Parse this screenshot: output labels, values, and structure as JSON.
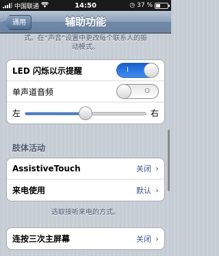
{
  "status_bar": {
    "carrier": "中国联通",
    "time": "14:50",
    "battery_text": "37 %",
    "battery_level": 0.37
  },
  "nav": {
    "back_label": "通用",
    "title": "辅助功能"
  },
  "top_footnote": {
    "line1": "式。在“声音”设置中更改每个联系人的振",
    "line2": "动模式。"
  },
  "hearing_group": {
    "led_flash_label": "LED 闪烁以示提醒",
    "led_flash_on": true,
    "led_flash_glyph": "I",
    "mono_audio_label": "单声道音频",
    "mono_audio_on": false,
    "mono_audio_glyph": "O",
    "balance_left": "左",
    "balance_right": "右",
    "balance_value": 0.5
  },
  "physical_section": {
    "header": "肢体活动",
    "items": [
      {
        "label": "AssistiveTouch",
        "value": "关闭"
      },
      {
        "label": "来电使用",
        "value": "默认"
      }
    ],
    "footnote": "选取接听来电的方式。"
  },
  "home_group": {
    "label": "连按三次主屏幕",
    "value": "关闭"
  },
  "icons": {
    "chevron": "›"
  }
}
